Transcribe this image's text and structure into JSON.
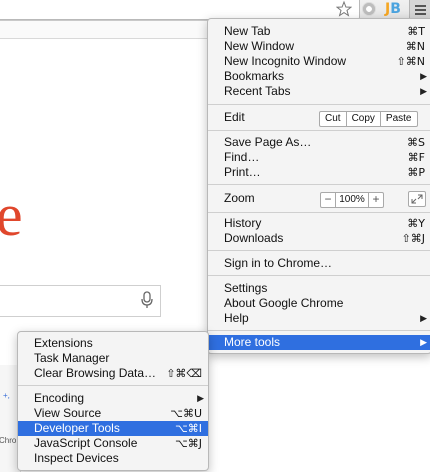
{
  "page": {
    "logo_fragment": "e",
    "widget_fragment": "Chro"
  },
  "main_menu": {
    "items": [
      {
        "label": "New Tab",
        "shortcut": "⌘T"
      },
      {
        "label": "New Window",
        "shortcut": "⌘N"
      },
      {
        "label": "New Incognito Window",
        "shortcut": "⇧⌘N"
      },
      {
        "label": "Bookmarks",
        "shortcut": "▶"
      },
      {
        "label": "Recent Tabs",
        "shortcut": "▶"
      }
    ],
    "edit": {
      "label": "Edit",
      "cut": "Cut",
      "copy": "Copy",
      "paste": "Paste"
    },
    "page_items": [
      {
        "label": "Save Page As…",
        "shortcut": "⌘S"
      },
      {
        "label": "Find…",
        "shortcut": "⌘F"
      },
      {
        "label": "Print…",
        "shortcut": "⌘P"
      }
    ],
    "zoom": {
      "label": "Zoom",
      "minus": "−",
      "value": "100%",
      "plus": "+"
    },
    "history": {
      "label": "History",
      "shortcut": "⌘Y"
    },
    "downloads": {
      "label": "Downloads",
      "shortcut": "⇧⌘J"
    },
    "sign_in": {
      "label": "Sign in to Chrome…"
    },
    "settings": {
      "label": "Settings"
    },
    "about": {
      "label": "About Google Chrome"
    },
    "help": {
      "label": "Help",
      "shortcut": "▶"
    },
    "more_tools": {
      "label": "More tools",
      "shortcut": "▶"
    }
  },
  "sub_menu": {
    "items": [
      {
        "label": "Extensions",
        "shortcut": ""
      },
      {
        "label": "Task Manager",
        "shortcut": ""
      },
      {
        "label": "Clear Browsing Data…",
        "shortcut": "⇧⌘⌫"
      },
      {
        "label": "Encoding",
        "shortcut": "▶"
      },
      {
        "label": "View Source",
        "shortcut": "⌥⌘U"
      },
      {
        "label": "Developer Tools",
        "shortcut": "⌥⌘I"
      },
      {
        "label": "JavaScript Console",
        "shortcut": "⌥⌘J"
      },
      {
        "label": "Inspect Devices",
        "shortcut": ""
      }
    ]
  },
  "colors": {
    "highlight": "#2f6fe0",
    "menu_bg": "#f4f4f4",
    "logo_red": "#e0472c"
  },
  "icons": [
    "star-icon",
    "extension-icon",
    "jb-extension-icon",
    "hamburger-menu-icon",
    "microphone-icon",
    "fullscreen-icon",
    "submenu-arrow-icon"
  ]
}
